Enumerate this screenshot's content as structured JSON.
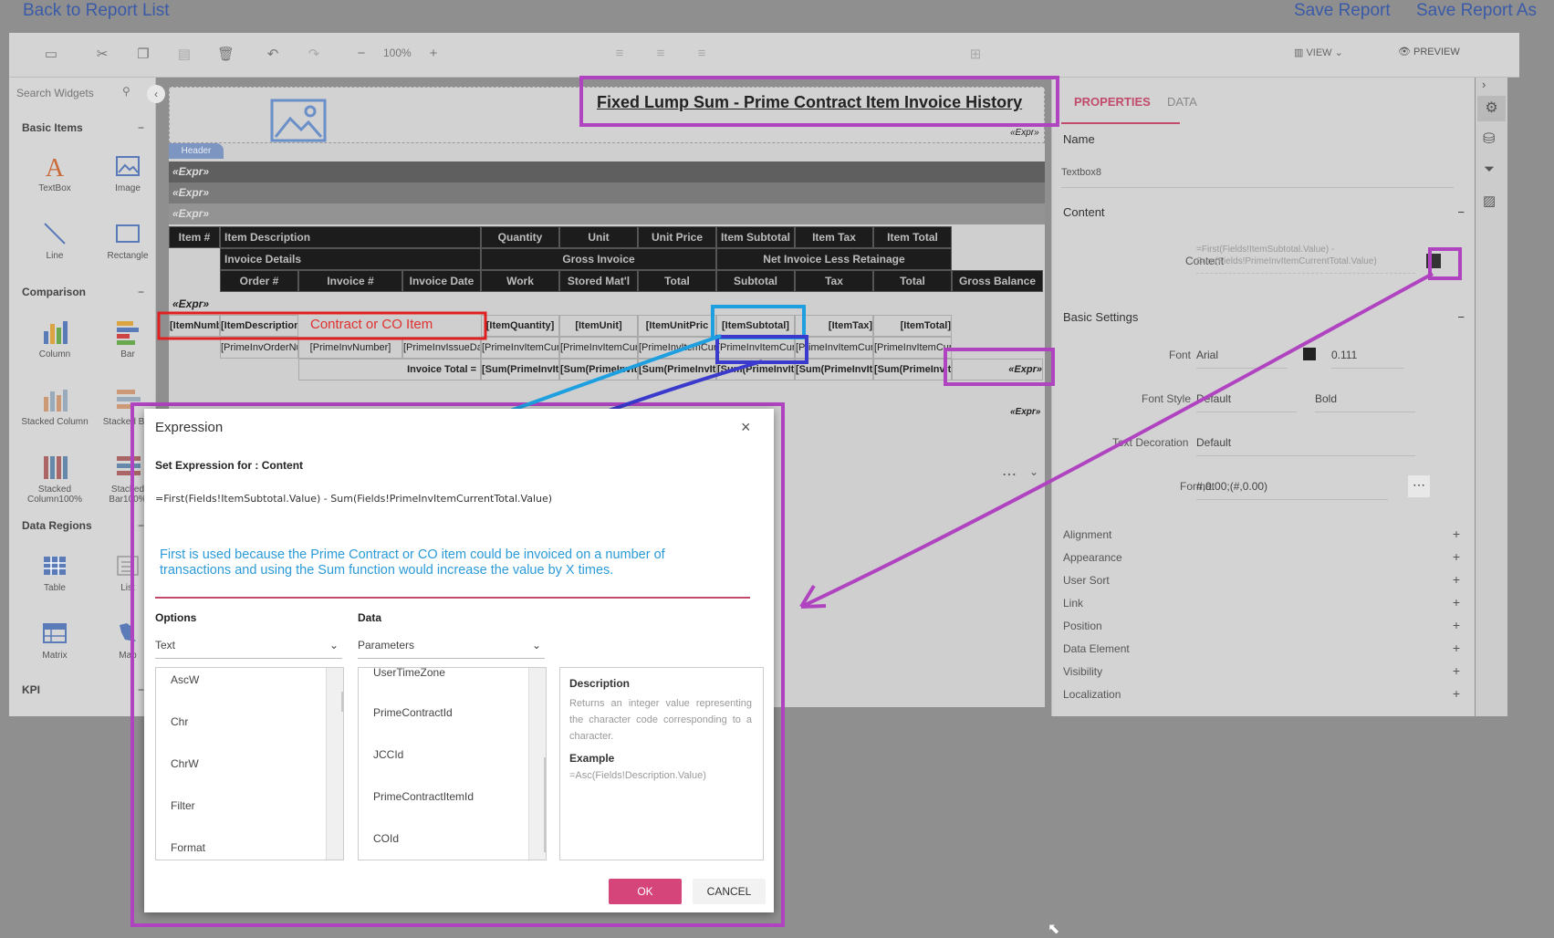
{
  "top": {
    "back": "Back to Report List",
    "save": "Save Report",
    "save_as": "Save Report As"
  },
  "toolbar": {
    "zoom": "100%",
    "view": "VIEW",
    "preview": "PREVIEW"
  },
  "sidebar": {
    "search_placeholder": "Search Widgets",
    "sections": {
      "basic": "Basic Items",
      "comparison": "Comparison",
      "data_regions": "Data Regions",
      "kpi": "KPI"
    },
    "widgets": {
      "textbox": "TextBox",
      "image": "Image",
      "line": "Line",
      "rectangle": "Rectangle",
      "column": "Column",
      "bar": "Bar",
      "stacked_column": "Stacked Column",
      "stacked_bar": "Stacked Bar",
      "stacked_column100": "Stacked Column100%",
      "stacked_bar100": "Stacked Bar100%",
      "table": "Table",
      "list": "List",
      "matrix": "Matrix",
      "map": "Map"
    }
  },
  "report": {
    "title": "Fixed Lump Sum -  Prime Contract Item Invoice History",
    "expr": "«Expr»",
    "header_tab": "Header",
    "row1": [
      "Item #",
      "Item Description",
      "Quantity",
      "Unit",
      "Unit Price",
      "Item Subtotal",
      "Item Tax",
      "Item Total"
    ],
    "row2": {
      "invoice_details": "Invoice Details",
      "gross_invoice": "Gross Invoice",
      "net_invoice": "Net Invoice Less Retainage"
    },
    "row3": [
      "Order #",
      "Invoice #",
      "Invoice Date",
      "Work",
      "Stored Mat'l",
      "Total",
      "Subtotal",
      "Tax",
      "Total",
      "Gross Balance"
    ],
    "data1": [
      "[ItemNumb",
      "[ItemDescription]",
      "[ItemQuantity]",
      "[ItemUnit]",
      "[ItemUnitPric",
      "[ItemSubtotal]",
      "[ItemTax]",
      "[ItemTotal]"
    ],
    "data2": [
      "[PrimeInvOrderNu",
      "[PrimeInvNumber]",
      "[PrimeInvIssueDat",
      "[PrimeInvItemCurr",
      "[PrimeInvItemCurr",
      "[PrimeInvItemCur",
      "[PrimeInvItemCur",
      "[PrimeInvItemCurr",
      "[PrimeInvItemCur"
    ],
    "total_label": "Invoice Total =",
    "data3": [
      "[Sum(PrimeInvIte",
      "[Sum(PrimeInvIte",
      "[Sum(PrimeInvIte",
      "[Sum(PrimeInvIte",
      "[Sum(PrimeInvIte",
      "[Sum(PrimeInvIte",
      "«Expr»"
    ],
    "annotation": "Contract or CO Item"
  },
  "properties": {
    "tabs": {
      "properties": "PROPERTIES",
      "data": "DATA"
    },
    "name_label": "Name",
    "name_value": "Textbox8",
    "content_section": "Content",
    "content_label": "Content",
    "content_value": "=First(Fields!ItemSubtotal.Value) - Sum(Fields!PrimeInvItemCurrentTotal.Value)",
    "basic_settings": "Basic Settings",
    "font_label": "Font",
    "font_value": "Arial",
    "font_size": "0.111",
    "font_style_label": "Font Style",
    "font_style_value": "Default",
    "font_weight": "Bold",
    "text_decoration_label": "Text Decoration",
    "text_decoration_value": "Default",
    "format_label": "Format",
    "format_value": "#,0.00;(#,0.00)",
    "groups": [
      "Alignment",
      "Appearance",
      "User Sort",
      "Link",
      "Position",
      "Data Element",
      "Visibility",
      "Localization"
    ]
  },
  "dialog": {
    "title": "Expression",
    "subtitle": "Set Expression for : Content",
    "expression": "=First(Fields!ItemSubtotal.Value) - Sum(Fields!PrimeInvItemCurrentTotal.Value)",
    "note": "First is used because the Prime Contract or CO item could be invoiced on a number of transactions and using the Sum function would increase the value by X times.",
    "options_label": "Options",
    "options_value": "Text",
    "data_label": "Data",
    "data_value": "Parameters",
    "options_items": [
      "AscW",
      "Chr",
      "ChrW",
      "Filter",
      "Format"
    ],
    "data_items": [
      "UserTimeZone",
      "PrimeContractId",
      "JCCId",
      "PrimeContractItemId",
      "COId"
    ],
    "desc_title": "Description",
    "desc_text": "Returns an integer value representing the character code corresponding to a character.",
    "example_title": "Example",
    "example_text": "=Asc(Fields!Description.Value)",
    "ok": "OK",
    "cancel": "CANCEL"
  }
}
